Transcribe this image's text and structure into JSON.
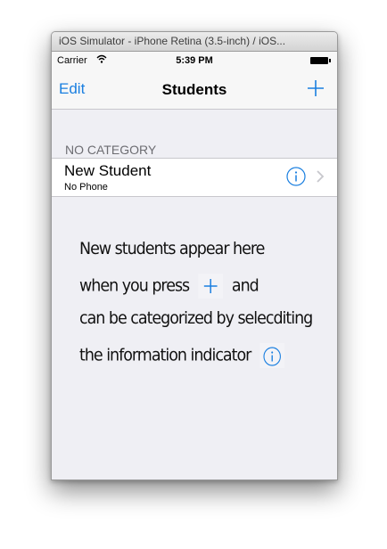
{
  "window": {
    "title": "iOS Simulator - iPhone Retina (3.5-inch) / iOS..."
  },
  "status_bar": {
    "carrier": "Carrier",
    "time": "5:39 PM",
    "wifi_icon": "wifi-icon",
    "battery_icon": "battery-icon"
  },
  "nav": {
    "left_label": "Edit",
    "title": "Students",
    "right_icon": "plus-icon"
  },
  "section": {
    "header": "NO CATEGORY"
  },
  "rows": [
    {
      "title": "New Student",
      "subtitle": "No Phone",
      "accessory_icons": [
        "info-icon",
        "chevron-right-icon"
      ]
    }
  ],
  "hint": {
    "line1": "New students appear here",
    "line2_before": "when you press",
    "line2_after": "and",
    "line3": "can be categorized by selecditing",
    "line4": "the information indicator"
  },
  "colors": {
    "accent": "#1a7fe0",
    "background": "#efeff4",
    "header_text": "#6d6d72"
  }
}
